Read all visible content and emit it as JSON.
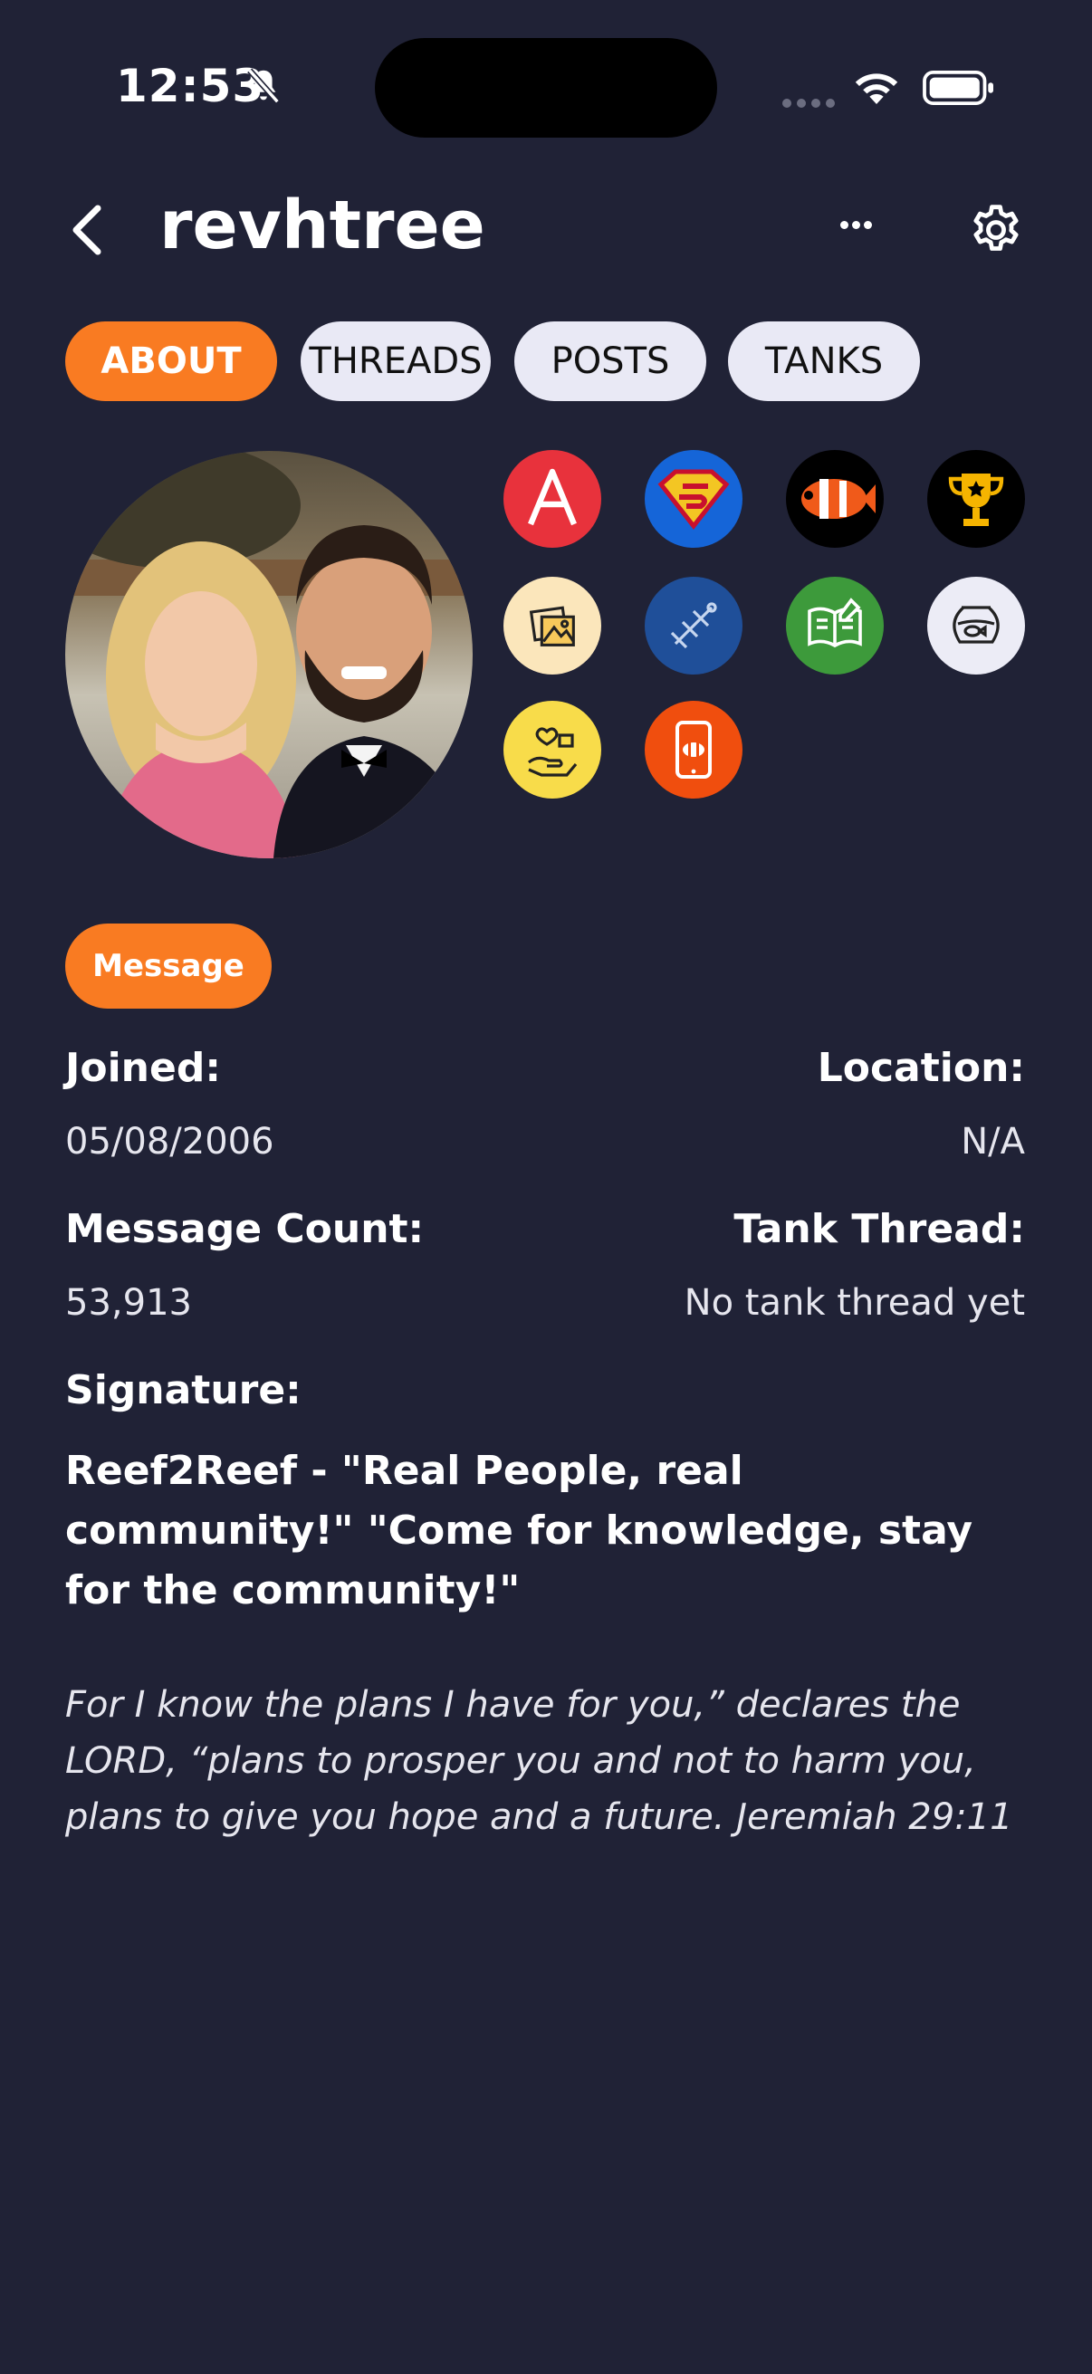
{
  "status_bar": {
    "time": "12:53",
    "icons": [
      "bell-slash-icon",
      "cellular-dots-icon",
      "wifi-icon",
      "battery-icon"
    ]
  },
  "header": {
    "title": "revhtree",
    "back_icon": "chevron-left-icon",
    "more_icon": "ellipsis-icon",
    "settings_icon": "gear-icon"
  },
  "tabs": [
    {
      "label": "ABOUT",
      "active": true
    },
    {
      "label": "THREADS",
      "active": false
    },
    {
      "label": "POSTS",
      "active": false
    },
    {
      "label": "TANKS",
      "active": false
    }
  ],
  "badges": [
    {
      "icon": "letter-a-badge-icon",
      "color": "#e8323c"
    },
    {
      "icon": "superman-badge-icon",
      "color": "#1565d8"
    },
    {
      "icon": "clownfish-badge-icon",
      "color": "#000000"
    },
    {
      "icon": "trophy-badge-icon",
      "color": "#000000"
    },
    {
      "icon": "art-gallery-badge-icon",
      "color": "#fbe6bb"
    },
    {
      "icon": "fighter-jet-badge-icon",
      "color": "#1f4f99"
    },
    {
      "icon": "book-badge-icon",
      "color": "#3d9a3b"
    },
    {
      "icon": "fishbowl-badge-icon",
      "color": "#ececf6"
    },
    {
      "icon": "helping-hands-badge-icon",
      "color": "#f8dc4a"
    },
    {
      "icon": "phone-clownfish-badge-icon",
      "color": "#f04e0e"
    }
  ],
  "message_button": "Message",
  "profile": {
    "joined_label": "Joined:",
    "joined_value": "05/08/2006",
    "location_label": "Location:",
    "location_value": "N/A",
    "message_count_label": "Message Count:",
    "message_count_value": "53,913",
    "tank_thread_label": "Tank Thread:",
    "tank_thread_value": "No tank thread yet",
    "signature_label": "Signature:",
    "signature_line1": "Reef2Reef - \"Real People, real community!\" \"Come for knowledge, stay for the community!\"",
    "signature_quote": "For I know the plans I have for you,” declares the LORD, “plans to prosper you and not to harm you, plans to give you hope and a future. Jeremiah 29:11"
  },
  "colors": {
    "background": "#202236",
    "accent": "#f97b22",
    "tab_inactive": "#e9e9f5"
  }
}
